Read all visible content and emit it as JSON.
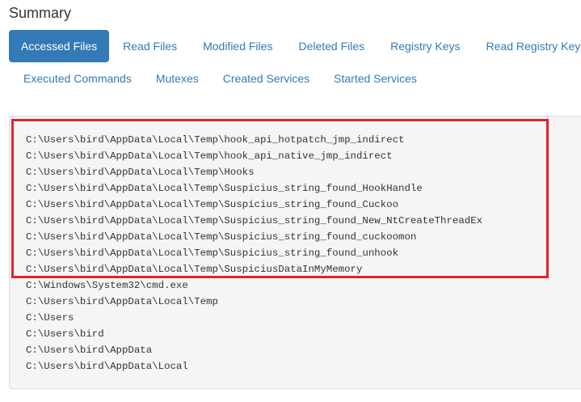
{
  "page_title": "Summary",
  "tabs_row1": [
    {
      "label": "Accessed Files",
      "active": true
    },
    {
      "label": "Read Files",
      "active": false
    },
    {
      "label": "Modified Files",
      "active": false
    },
    {
      "label": "Deleted Files",
      "active": false
    },
    {
      "label": "Registry Keys",
      "active": false
    },
    {
      "label": "Read Registry Keys",
      "active": false
    }
  ],
  "tabs_row2": [
    {
      "label": "Executed Commands",
      "active": false
    },
    {
      "label": "Mutexes",
      "active": false
    },
    {
      "label": "Created Services",
      "active": false
    },
    {
      "label": "Started Services",
      "active": false
    }
  ],
  "files": [
    "C:\\Users\\bird\\AppData\\Local\\Temp\\hook_api_hotpatch_jmp_indirect",
    "C:\\Users\\bird\\AppData\\Local\\Temp\\hook_api_native_jmp_indirect",
    "C:\\Users\\bird\\AppData\\Local\\Temp\\Hooks",
    "C:\\Users\\bird\\AppData\\Local\\Temp\\Suspicius_string_found_HookHandle",
    "C:\\Users\\bird\\AppData\\Local\\Temp\\Suspicius_string_found_Cuckoo",
    "C:\\Users\\bird\\AppData\\Local\\Temp\\Suspicius_string_found_New_NtCreateThreadEx",
    "C:\\Users\\bird\\AppData\\Local\\Temp\\Suspicius_string_found_cuckoomon",
    "C:\\Users\\bird\\AppData\\Local\\Temp\\Suspicius_string_found_unhook",
    "C:\\Users\\bird\\AppData\\Local\\Temp\\SuspiciusDataInMyMemory",
    "C:\\Windows\\System32\\cmd.exe",
    "C:\\Users\\bird\\AppData\\Local\\Temp",
    "C:\\Users",
    "C:\\Users\\bird",
    "C:\\Users\\bird\\AppData",
    "C:\\Users\\bird\\AppData\\Local"
  ],
  "colors": {
    "accent": "#337ab7",
    "highlight": "#e8202a",
    "panel_bg": "#f5f5f5"
  }
}
